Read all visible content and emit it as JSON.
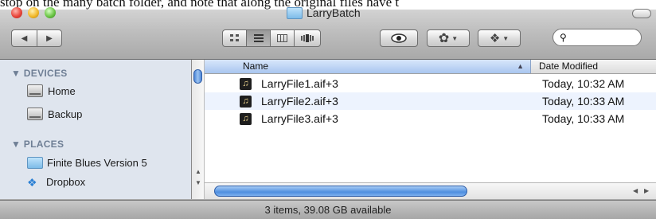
{
  "background_text": "stop on the many batch folder, and note that along the original files have t",
  "window": {
    "title": "LarryBatch"
  },
  "toolbar": {
    "nav": {
      "back": "◀",
      "forward": "▶"
    },
    "views": [
      "icon-view",
      "list-view",
      "column-view",
      "coverflow-view"
    ],
    "selected_view": "list-view",
    "search": {
      "value": "",
      "placeholder": ""
    }
  },
  "sidebar": {
    "devices_header": "▼ DEVICES",
    "devices": [
      {
        "label": "Home",
        "icon": "disk-icon"
      },
      {
        "label": "Backup",
        "icon": "disk-icon"
      }
    ],
    "places_header": "▼ PLACES",
    "places": [
      {
        "label": "Finite Blues Version 5",
        "icon": "folder-icon"
      },
      {
        "label": "Dropbox",
        "icon": "dropbox-icon"
      }
    ]
  },
  "list": {
    "columns": {
      "name": "Name",
      "date": "Date Modified"
    },
    "rows": [
      {
        "name": "LarryFile1.aif+3",
        "date": "Today, 10:32 AM"
      },
      {
        "name": "LarryFile2.aif+3",
        "date": "Today, 10:33 AM"
      },
      {
        "name": "LarryFile3.aif+3",
        "date": "Today, 10:33 AM"
      }
    ]
  },
  "status": "3 items, 39.08 GB available"
}
